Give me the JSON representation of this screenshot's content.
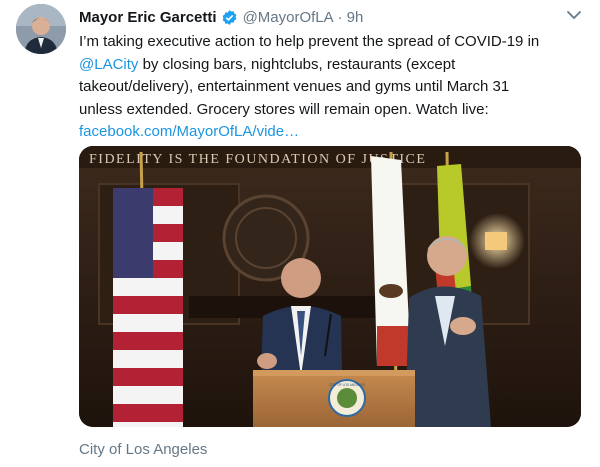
{
  "tweet": {
    "author_name": "Mayor Eric Garcetti",
    "handle": "@MayorOfLA",
    "separator": "·",
    "time": "9h",
    "lines": [
      [
        {
          "text": "I’m taking executive action to help prevent the spread of COVID-19 in",
          "link": false
        }
      ],
      [
        {
          "text": "@LACity",
          "link": true
        },
        {
          "text": " by closing bars, nightclubs, restaurants (except",
          "link": false
        }
      ],
      [
        {
          "text": "takeout/delivery), entertainment venues and gyms until March 31",
          "link": false
        }
      ],
      [
        {
          "text": "unless extended. Grocery stores will remain open. Watch live:",
          "link": false
        }
      ],
      [
        {
          "text": "facebook.com/MayorOfLA/vide…",
          "link": true
        }
      ]
    ]
  },
  "media": {
    "wall_inscription": "FIDELITY IS THE FOUNDATION OF JUSTICE",
    "podium_seal": "CITY OF LOS ANGELES"
  },
  "caption": "City of Los Angeles",
  "colors": {
    "link": "#1b95e0",
    "verified": "#1da1f2",
    "muted": "#657786"
  },
  "icons": {
    "verified": "verified-badge-icon",
    "caret": "chevron-down-icon"
  }
}
